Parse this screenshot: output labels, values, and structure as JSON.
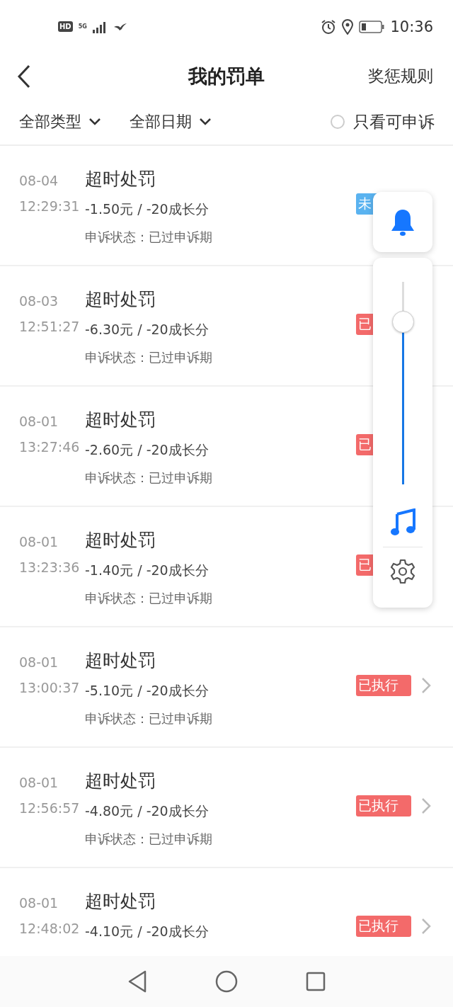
{
  "status_bar": {
    "time": "10:36",
    "hd": "HD",
    "network": "5G"
  },
  "header": {
    "title": "我的罚单",
    "action": "奖惩规则"
  },
  "filters": {
    "type": "全部类型",
    "date": "全部日期",
    "appeal_only": {
      "label": "只看可申诉",
      "checked": false
    }
  },
  "penalties": [
    {
      "date": "08-04",
      "time": "12:29:31",
      "title": "超时处罚",
      "amount": "-1.50元 / -20成长分",
      "status": "申诉状态：已过申诉期",
      "badge": {
        "kind": "pending",
        "text": "未"
      }
    },
    {
      "date": "08-03",
      "time": "12:51:27",
      "title": "超时处罚",
      "amount": "-6.30元 / -20成长分",
      "status": "申诉状态：已过申诉期",
      "badge": {
        "kind": "executed",
        "text": "已"
      }
    },
    {
      "date": "08-01",
      "time": "13:27:46",
      "title": "超时处罚",
      "amount": "-2.60元 / -20成长分",
      "status": "申诉状态：已过申诉期",
      "badge": {
        "kind": "executed",
        "text": "已"
      }
    },
    {
      "date": "08-01",
      "time": "13:23:36",
      "title": "超时处罚",
      "amount": "-1.40元 / -20成长分",
      "status": "申诉状态：已过申诉期",
      "badge": {
        "kind": "executed",
        "text": "已"
      }
    },
    {
      "date": "08-01",
      "time": "13:00:37",
      "title": "超时处罚",
      "amount": "-5.10元 / -20成长分",
      "status": "申诉状态：已过申诉期",
      "badge": {
        "kind": "executed",
        "text": "已执行"
      },
      "chevron": true
    },
    {
      "date": "08-01",
      "time": "12:56:57",
      "title": "超时处罚",
      "amount": "-4.80元 / -20成长分",
      "status": "申诉状态：已过申诉期",
      "badge": {
        "kind": "executed",
        "text": "已执行"
      },
      "chevron": true
    },
    {
      "date": "08-01",
      "time": "12:48:02",
      "title": "超时处罚",
      "amount": "-4.10元 / -20成长分",
      "badge": {
        "kind": "executed",
        "text": "已执行"
      },
      "chevron": true
    }
  ],
  "volume_panel": {
    "level": 0.8
  }
}
